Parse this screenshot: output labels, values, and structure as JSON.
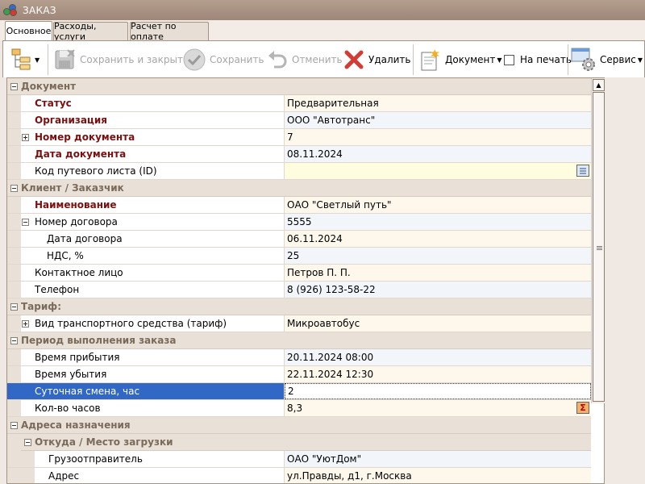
{
  "window": {
    "title": "ЗАКАЗ"
  },
  "tabs": [
    {
      "label": "Основное"
    },
    {
      "label": "Расходы, услуги"
    },
    {
      "label": "Расчет по оплате"
    }
  ],
  "toolbar": {
    "save_close_label": "Сохранить и закрыть",
    "save_label": "Сохранить",
    "cancel_label": "Отменить",
    "delete_label": "Удалить",
    "document_label": "Документ",
    "print_label": "На печать",
    "service_label": "Сервис"
  },
  "grid": {
    "document": {
      "title": "Документ",
      "status": {
        "name": "Статус",
        "value": "Предварительная"
      },
      "org": {
        "name": "Организация",
        "value": "ООО \"Автотранс\""
      },
      "docnum": {
        "name": "Номер документа",
        "value": "7"
      },
      "docdate": {
        "name": "Дата документа",
        "value": "08.11.2024"
      },
      "waybill": {
        "name": "Код путевого листа (ID)",
        "value": ""
      }
    },
    "client": {
      "title": "Клиент / Заказчик",
      "name": {
        "name": "Наименование",
        "value": "ОАО \"Светлый путь\""
      },
      "contract": {
        "name": "Номер договора",
        "value": "5555"
      },
      "contract_date": {
        "name": "Дата договора",
        "value": "06.11.2024"
      },
      "vat": {
        "name": "НДС, %",
        "value": "25"
      },
      "contact": {
        "name": "Контактное лицо",
        "value": "Петров П. П."
      },
      "phone": {
        "name": "Телефон",
        "value": "8 (926) 123-58-22"
      }
    },
    "tariff": {
      "title": "Тариф:",
      "vehicle": {
        "name": "Вид транспортного средства (тариф)",
        "value": "Микроавтобус"
      }
    },
    "period": {
      "title": "Период выполнения заказа",
      "arrival": {
        "name": "Время прибытия",
        "value": "20.11.2024 08:00"
      },
      "departure": {
        "name": "Время убытия",
        "value": "22.11.2024 12:30"
      },
      "shift": {
        "name": "Суточная смена, час",
        "value": "2"
      },
      "hours": {
        "name": "Кол-во часов",
        "value": "8,3"
      }
    },
    "addresses": {
      "title": "Адреса назначения",
      "from": {
        "title": "Откуда / Место загрузки",
        "shipper": {
          "name": "Грузоотправитель",
          "value": "ОАО \"УютДом\""
        },
        "address": {
          "name": "Адрес",
          "value": "ул.Правды, д1, г.Москва"
        }
      }
    }
  },
  "colors": {
    "titlebar": "#a8907f",
    "selection": "#3168c6",
    "required_label": "#7a1010",
    "category_bg": "#e9e1d8"
  }
}
